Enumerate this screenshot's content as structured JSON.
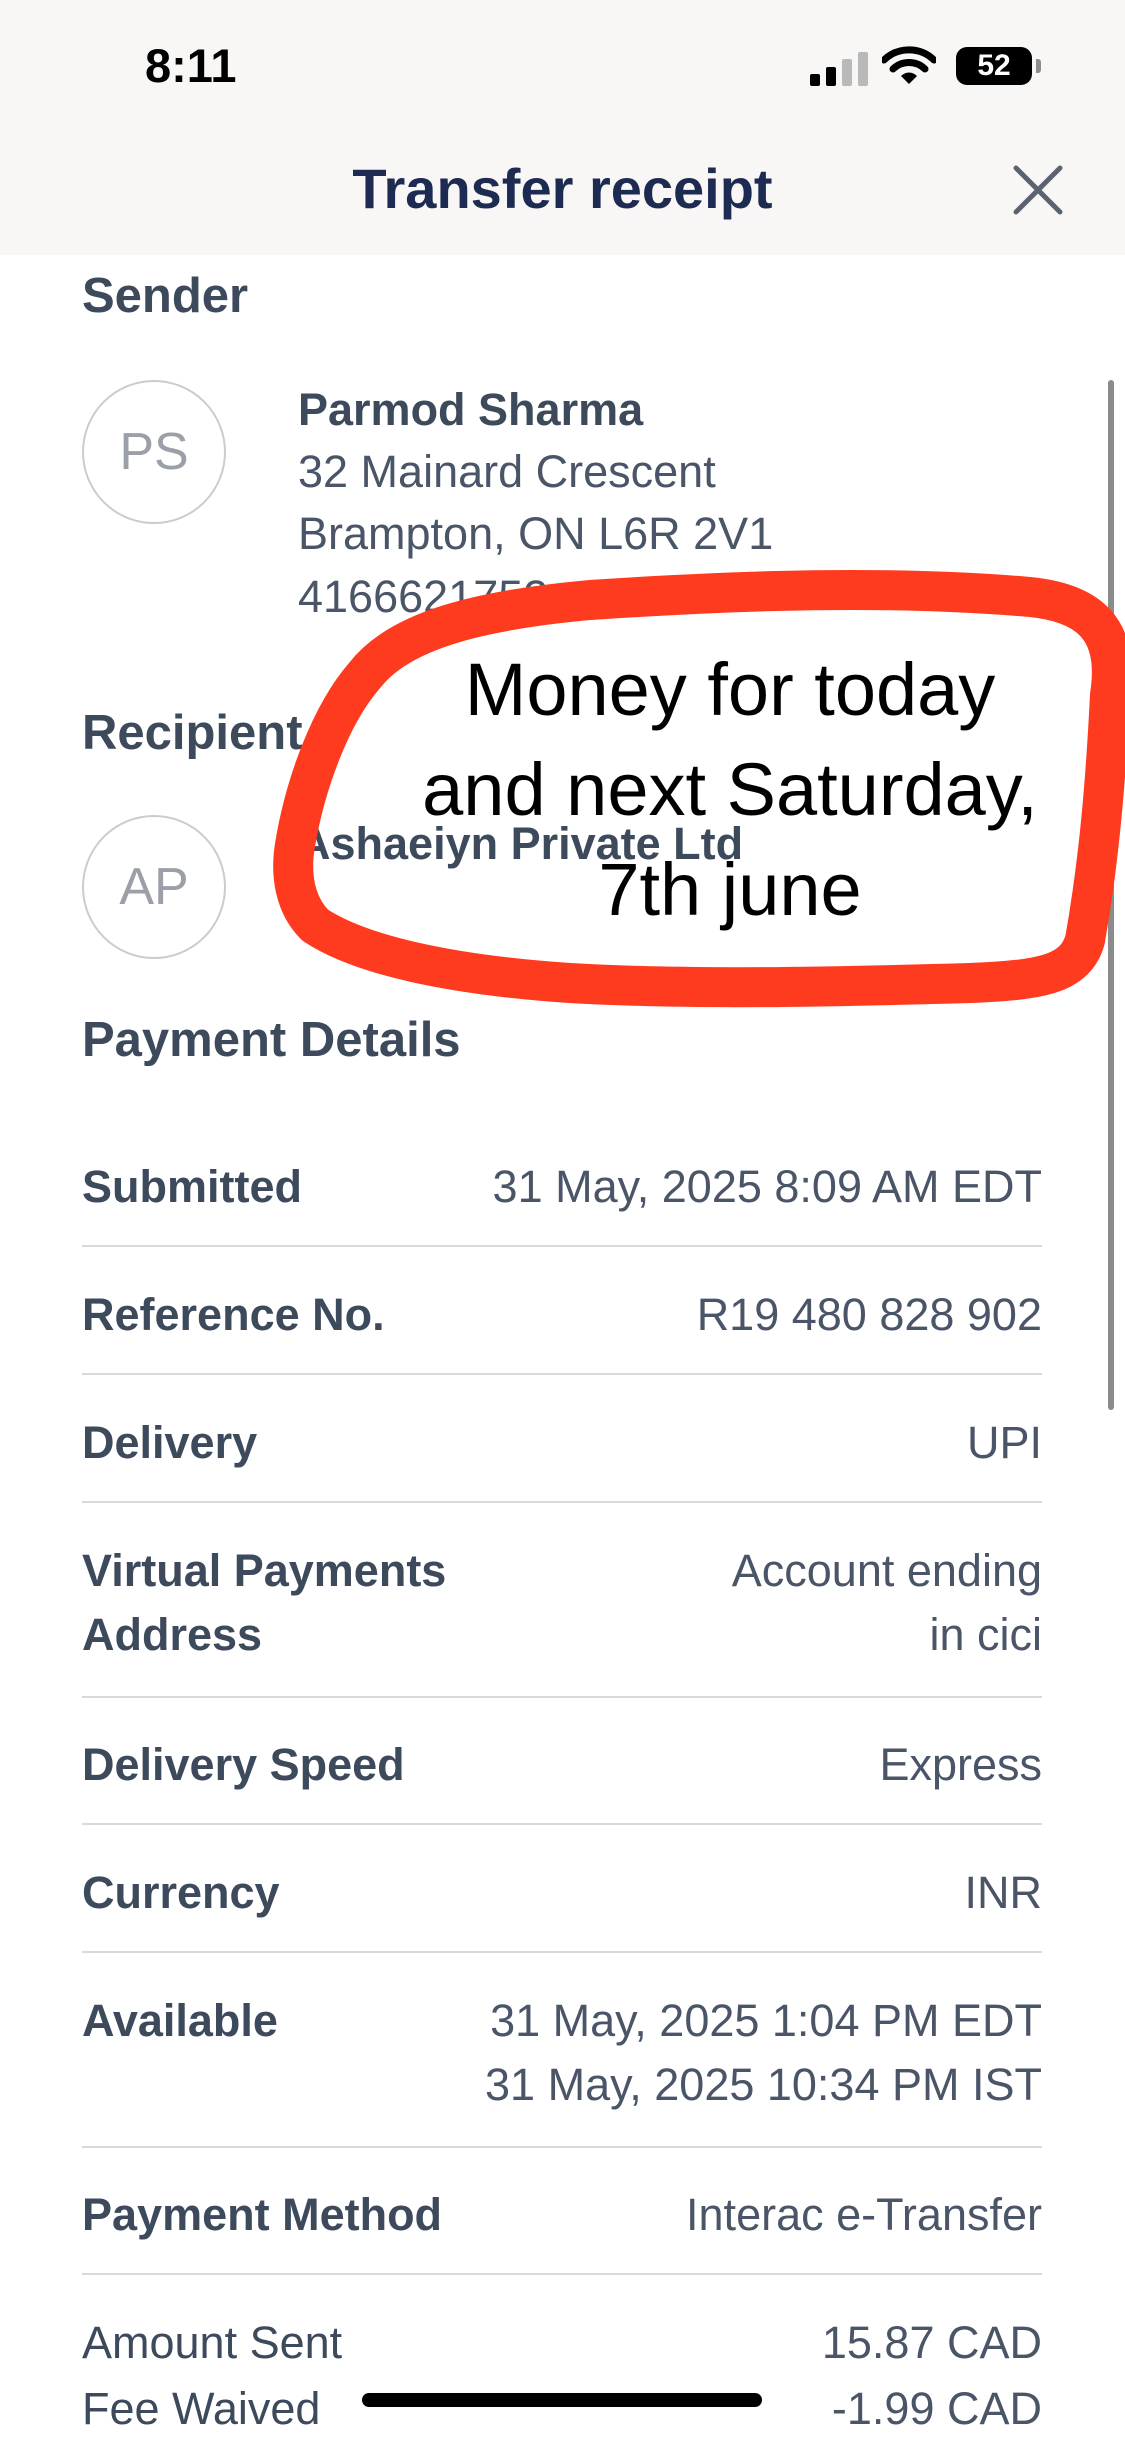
{
  "status_bar": {
    "time": "8:11",
    "battery": "52"
  },
  "header": {
    "title": "Transfer receipt"
  },
  "sender": {
    "section_title": "Sender",
    "initials": "PS",
    "name": "Parmod Sharma",
    "address_line1": "32 Mainard Crescent",
    "address_line2": "Brampton, ON L6R 2V1",
    "phone": "4166621752"
  },
  "recipient": {
    "section_title": "Recipient",
    "initials": "AP",
    "name": "Ashaeiyn Private Ltd"
  },
  "annotation": {
    "text_line1": "Money for today",
    "text_line2": "and next Saturday,",
    "text_line3": "7th june",
    "color": "#ff3b1f"
  },
  "payment_details": {
    "section_title": "Payment Details",
    "rows": [
      {
        "label": "Submitted",
        "value": "31 May, 2025 8:09 AM EDT"
      },
      {
        "label": "Reference No.",
        "value": "R19 480 828 902"
      },
      {
        "label": "Delivery",
        "value": "UPI"
      },
      {
        "label_line1": "Virtual Payments",
        "label_line2": "Address",
        "value_line1": "Account ending",
        "value_line2": "in cici"
      },
      {
        "label": "Delivery Speed",
        "value": "Express"
      },
      {
        "label": "Currency",
        "value": "INR"
      },
      {
        "label": "Available",
        "value_line1": "31 May, 2025 1:04 PM EDT",
        "value_line2": "31 May, 2025 10:34 PM IST"
      },
      {
        "label": "Payment Method",
        "value": "Interac e-Transfer"
      }
    ],
    "amounts": [
      {
        "label": "Amount Sent",
        "value": "15.87 CAD"
      },
      {
        "label": "Fee Waived",
        "value": "-1.99 CAD"
      }
    ]
  },
  "icons": [
    "signal-icon",
    "wifi-icon",
    "battery-icon",
    "close-icon"
  ]
}
